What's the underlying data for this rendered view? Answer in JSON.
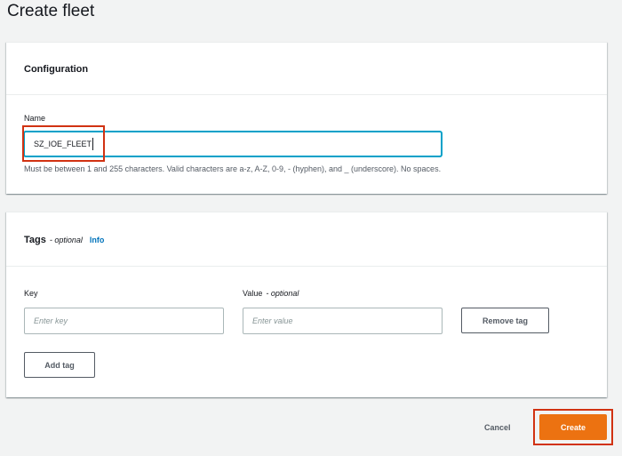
{
  "page": {
    "title": "Create fleet"
  },
  "configuration": {
    "title": "Configuration",
    "name_label": "Name",
    "name_value": "SZ_IOE_FLEET",
    "hint": "Must be between 1 and 255 characters. Valid characters are a-z, A-Z, 0-9, - (hyphen), and _ (underscore). No spaces."
  },
  "tags": {
    "title": "Tags",
    "optional": "- optional",
    "info": "Info",
    "key_label": "Key",
    "value_label": "Value",
    "value_optional": "- optional",
    "key_placeholder": "Enter key",
    "value_placeholder": "Enter value",
    "remove_label": "Remove tag",
    "add_label": "Add tag"
  },
  "footer": {
    "cancel_label": "Cancel",
    "create_label": "Create"
  },
  "colors": {
    "primary": "#ec7211",
    "focus": "#00a1c9",
    "highlight": "#d13212",
    "link": "#0073bb"
  }
}
